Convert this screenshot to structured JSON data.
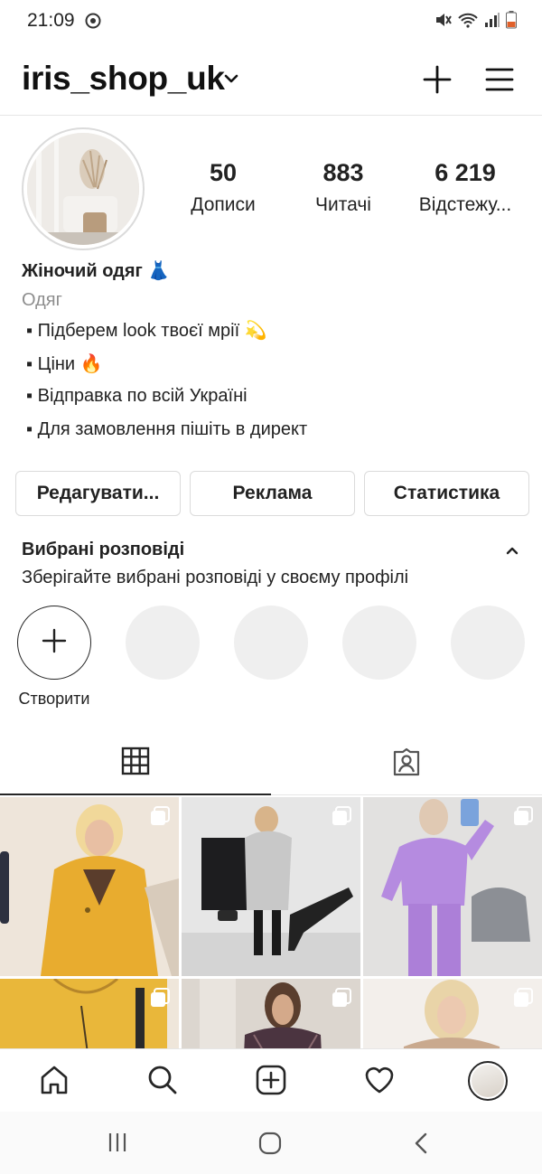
{
  "status_bar": {
    "time": "21:09"
  },
  "header": {
    "username": "iris_shop_uk"
  },
  "stats": [
    {
      "value": "50",
      "label": "Дописи"
    },
    {
      "value": "883",
      "label": "Читачі"
    },
    {
      "value": "6 219",
      "label": "Відстежу..."
    }
  ],
  "bio": {
    "name": "Жіночий одяг 👗",
    "category": "Одяг",
    "lines": [
      "▪ Підберем  look твоєї мрії 💫",
      "▪ Ціни 🔥",
      "▪ Відправка по всій Україні",
      "▪ Для замовлення пішіть в директ"
    ]
  },
  "buttons": {
    "edit": "Редагувати...",
    "ads": "Реклама",
    "stats": "Статистика"
  },
  "highlights": {
    "title": "Вибрані розповіді",
    "subtitle": "Зберігайте вибрані розповіді у своєму профілі",
    "new_label": "Створити"
  },
  "colors": {
    "text": "#262626",
    "muted": "#8e8e8e",
    "border": "#dbdbdb",
    "placeholder": "#efefef"
  },
  "icons": [
    "mute-icon",
    "wifi-icon",
    "signal-icon",
    "battery-icon",
    "plus-icon",
    "menu-icon",
    "grid-icon",
    "tagged-icon",
    "home-icon",
    "search-icon",
    "new-post-icon",
    "heart-icon",
    "recents-icon",
    "home-button-icon",
    "back-icon"
  ]
}
